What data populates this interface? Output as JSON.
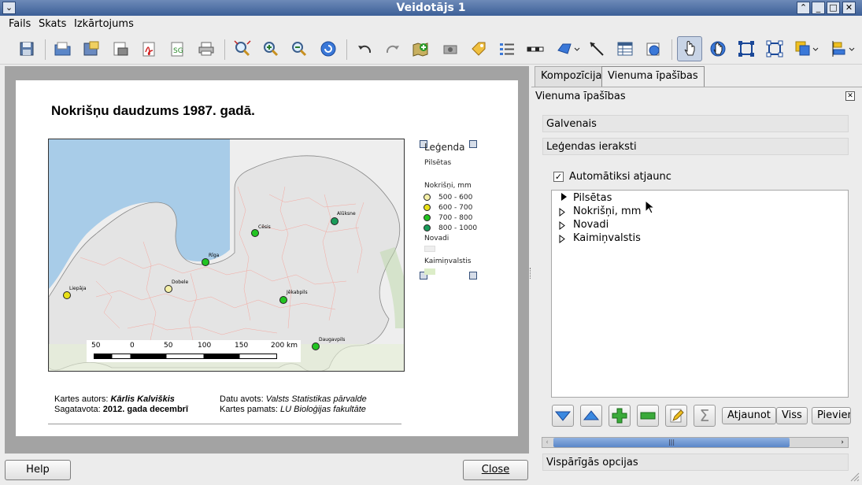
{
  "window": {
    "title": "Veidotājs 1"
  },
  "menu": {
    "items": [
      "Fails",
      "Skats",
      "Izkārtojums"
    ]
  },
  "toolbar": {
    "icons": [
      "save-icon",
      "open-template-icon",
      "save-template-icon",
      "export-image-icon",
      "export-pdf-icon",
      "export-svg-icon",
      "print-icon",
      "zoom-full-icon",
      "zoom-in-icon",
      "zoom-out-icon",
      "refresh-icon",
      "undo-icon",
      "redo-icon",
      "add-map-icon",
      "add-image-icon",
      "add-label-icon",
      "add-legend-icon",
      "add-scalebar-icon",
      "add-shape-icon",
      "add-arrow-icon",
      "add-table-icon",
      "add-html-icon",
      "select-move-icon",
      "move-content-icon",
      "group-icon",
      "ungroup-icon",
      "raise-icon",
      "align-icon"
    ]
  },
  "composition": {
    "title": "Nokrišņu daudzums 1987. gadā.",
    "legend": {
      "title": "Leģenda",
      "pilsetas": "Pilsētas",
      "nokrisni_title": "Nokrišņi, mm",
      "classes": [
        {
          "label": "500 - 600",
          "color": "#f5f0a8"
        },
        {
          "label": "600 - 700",
          "color": "#e8e017"
        },
        {
          "label": "700 - 800",
          "color": "#22c422"
        },
        {
          "label": "800 - 1000",
          "color": "#1a9c5a"
        }
      ],
      "novadi": "Novadi",
      "kaiminvalstis": "Kaimiņvalstis"
    },
    "cities": [
      {
        "name": "Alūksne"
      },
      {
        "name": "Cēsis"
      },
      {
        "name": "Rīga"
      },
      {
        "name": "Dobele"
      },
      {
        "name": "Liepāja"
      },
      {
        "name": "Jēkabpils"
      },
      {
        "name": "Daugavpils"
      }
    ],
    "scalebar": {
      "labels": [
        "50",
        "0",
        "50",
        "100",
        "150",
        "200 km"
      ]
    },
    "footer": {
      "author_label": "Kartes autors:",
      "author": "Kārlis Kalviškis",
      "prepared_label": "Sagatavota:",
      "prepared": "2012. gada decembrī",
      "source_label": "Datu avots:",
      "source": "Valsts Statistikas pārvalde",
      "base_label": "Kartes pamats:",
      "base": "LU Bioloģijas fakultāte"
    }
  },
  "panel": {
    "tabs": [
      "Kompozīcija",
      "Vienuma īpašības"
    ],
    "header": "Vienuma īpašības",
    "sections": [
      "Galvenais",
      "Leģendas ieraksti"
    ],
    "auto_update_label": "Automātiksi atjaunc",
    "tree": [
      "Pilsētas",
      "Nokrišņi, mm",
      "Novadi",
      "Kaimiņvalstis"
    ],
    "buttons": {
      "update": "Atjaunot",
      "all": "Viss",
      "add": "Pievien"
    },
    "general_options": "Vispārīgās opcijas"
  },
  "bottom": {
    "help": "Help",
    "close": "Close"
  }
}
